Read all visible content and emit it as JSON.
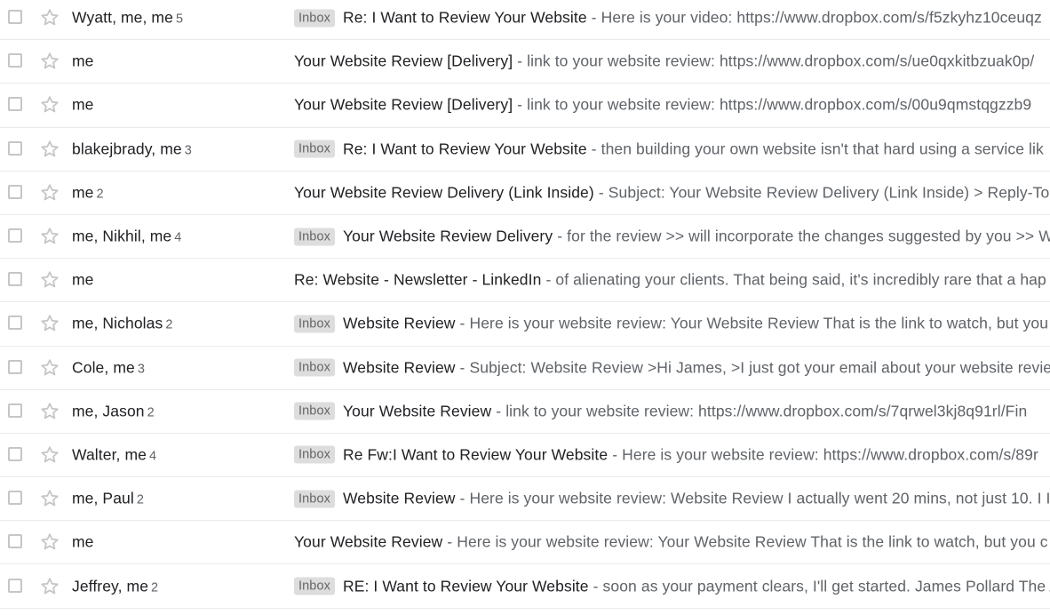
{
  "label_text": "Inbox",
  "colors": {
    "sender": "#202124",
    "snippet": "#5f6368",
    "label_bg": "#dddddd",
    "divider": "#e8eaed"
  },
  "rows": [
    {
      "sender": "Wyatt, me, me",
      "count": "5",
      "label": true,
      "subject": "Re: I Want to Review Your Website",
      "snippet": "Here is your video: https://www.dropbox.com/s/f5zkyhz10ceuqz"
    },
    {
      "sender": "me",
      "count": "",
      "label": false,
      "subject": "Your Website Review [Delivery]",
      "snippet": "link to your website review: https://www.dropbox.com/s/ue0qxkitbzuak0p/"
    },
    {
      "sender": "me",
      "count": "",
      "label": false,
      "subject": "Your Website Review [Delivery]",
      "snippet": "link to your website review: https://www.dropbox.com/s/00u9qmstqgzzb9"
    },
    {
      "sender": "blakejbrady, me",
      "count": "3",
      "label": true,
      "subject": "Re: I Want to Review Your Website",
      "snippet": "then building your own website isn't that hard using a service lik"
    },
    {
      "sender": "me",
      "count": "2",
      "label": false,
      "subject": "Your Website Review Delivery (Link Inside)",
      "snippet": "Subject: Your Website Review Delivery (Link Inside) > Reply-To:"
    },
    {
      "sender": "me, Nikhil, me",
      "count": "4",
      "label": true,
      "subject": "Your Website Review Delivery",
      "snippet": "for the review >> will incorporate the changes suggested by you >> W"
    },
    {
      "sender": "me",
      "count": "",
      "label": false,
      "subject": "Re: Website - Newsletter - LinkedIn",
      "snippet": "of alienating your clients. That being said, it's incredibly rare that a hap"
    },
    {
      "sender": "me, Nicholas",
      "count": "2",
      "label": true,
      "subject": "Website Review",
      "snippet": "Here is your website review: Your Website Review That is the link to watch, but you"
    },
    {
      "sender": "Cole, me",
      "count": "3",
      "label": true,
      "subject": "Website Review",
      "snippet": "Subject: Website Review >Hi James, >I just got your email about your website revie"
    },
    {
      "sender": "me, Jason",
      "count": "2",
      "label": true,
      "subject": "Your Website Review",
      "snippet": "link to your website review: https://www.dropbox.com/s/7qrwel3kj8q91rl/Fin"
    },
    {
      "sender": "Walter, me",
      "count": "4",
      "label": true,
      "subject": "Re Fw:I Want to Review Your Website",
      "snippet": "Here is your website review: https://www.dropbox.com/s/89r"
    },
    {
      "sender": "me, Paul",
      "count": "2",
      "label": true,
      "subject": "Website Review",
      "snippet": "Here is your website review: Website Review I actually went 20 mins, not just 10. I I"
    },
    {
      "sender": "me",
      "count": "",
      "label": false,
      "subject": "Your Website Review",
      "snippet": "Here is your website review: Your Website Review That is the link to watch, but you c"
    },
    {
      "sender": "Jeffrey, me",
      "count": "2",
      "label": true,
      "subject": "RE: I Want to Review Your Website",
      "snippet": "soon as your payment clears, I'll get started. James Pollard The A"
    }
  ]
}
